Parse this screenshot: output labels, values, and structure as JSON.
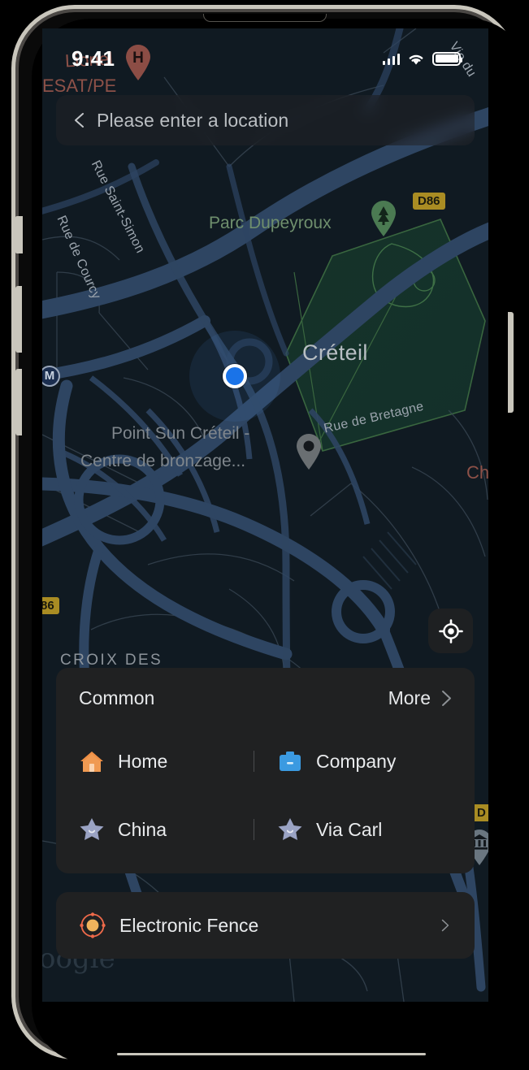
{
  "status_bar": {
    "time": "9:41",
    "cellular_icon": "signal-bars-icon",
    "wifi_icon": "wifi-icon",
    "battery_icon": "battery-full-icon"
  },
  "search": {
    "back_icon": "chevron-left-icon",
    "placeholder": "Please enter a location",
    "value": ""
  },
  "map": {
    "locate_button_icon": "crosshair-locate-icon",
    "user_location_marker": "blue-location-dot",
    "labels": [
      {
        "text": "Lionel",
        "kind": "red-poi"
      },
      {
        "text": "ESAT/PE",
        "kind": "red-poi"
      },
      {
        "text": "Rue Saint-Simon",
        "kind": "street"
      },
      {
        "text": "Rue de Courcy",
        "kind": "street"
      },
      {
        "text": "Parc Dupeyroux",
        "kind": "park"
      },
      {
        "text": "Créteil",
        "kind": "city"
      },
      {
        "text": "Rue de Bretagne",
        "kind": "street"
      },
      {
        "text": "Point Sun Créteil -",
        "kind": "poi"
      },
      {
        "text": "Centre de bronzage...",
        "kind": "poi"
      },
      {
        "text": "CROIX DES",
        "kind": "area"
      },
      {
        "text": "Ch",
        "kind": "red-poi"
      },
      {
        "text": "Vie du",
        "kind": "street"
      },
      {
        "text": "oogle",
        "kind": "watermark"
      }
    ],
    "road_shields": [
      {
        "text": "D86"
      },
      {
        "text": "86"
      },
      {
        "text": "D"
      }
    ],
    "markers": [
      {
        "icon": "hospital-pin-icon",
        "letter": "H"
      },
      {
        "icon": "park-tree-pin-icon"
      },
      {
        "icon": "generic-place-pin-icon"
      },
      {
        "icon": "metro-station-icon",
        "letter": "M"
      },
      {
        "icon": "museum-pin-icon"
      }
    ]
  },
  "common_panel": {
    "title": "Common",
    "more_label": "More",
    "more_icon": "chevron-right-icon",
    "favorites": [
      {
        "label": "Home",
        "icon": "home-icon"
      },
      {
        "label": "Company",
        "icon": "briefcase-icon"
      },
      {
        "label": "China",
        "icon": "star-icon"
      },
      {
        "label": "Via Carl",
        "icon": "star-icon"
      }
    ]
  },
  "fence_panel": {
    "label": "Electronic Fence",
    "icon": "electronic-fence-icon",
    "chevron_icon": "chevron-right-icon"
  },
  "colors": {
    "accent_blue": "#1a73e8",
    "home_orange": "#ef8f45",
    "company_blue": "#3b9ae1",
    "star_lavender": "#9aa3c4",
    "fence_orange": "#ef6a4a",
    "panel_bg": "#202122",
    "map_bg": "#101a22"
  }
}
